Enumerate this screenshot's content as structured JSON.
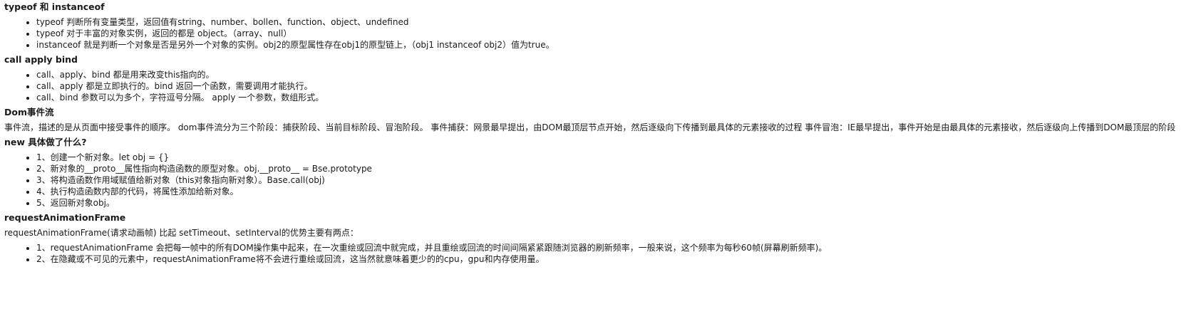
{
  "sections": [
    {
      "heading": "typeof 和 instanceof",
      "items": [
        "typeof 判断所有变量类型，返回值有string、number、bollen、function、object、undefined",
        "typeof 对于丰富的对象实例，返回的都是 object。（array、null）",
        "instanceof 就是判断一个对象是否是另外一个对象的实例。obj2的原型属性存在obj1的原型链上，（obj1 instanceof obj2）值为true。"
      ]
    },
    {
      "heading": "call apply bind",
      "items": [
        "call、apply、bind 都是用来改变this指向的。",
        "call、apply 都是立即执行的。bind 返回一个函数，需要调用才能执行。",
        "call、bind 参数可以为多个，字符逗号分隔。 apply 一个参数，数组形式。"
      ]
    },
    {
      "heading": "Dom事件流",
      "paragraph": "事件流，描述的是从页面中接受事件的顺序。 dom事件流分为三个阶段：捕获阶段、当前目标阶段、冒泡阶段。 事件捕获：网景最早提出，由DOM最顶层节点开始，然后逐级向下传播到最具体的元素接收的过程 事件冒泡：IE最早提出，事件开始是由最具体的元素接收，然后逐级向上传播到DOM最顶层的阶段"
    },
    {
      "heading": "new 具体做了什么?",
      "items": [
        "1、创建一个新对象。let obj = {}",
        "2、新对象的__proto__属性指向构造函数的原型对象。obj.__proto__ = Bse.prototype",
        "3、将构造函数作用域赋值给新对象（this对象指向新对象）。Base.call(obj)",
        "4、执行构造函数内部的代码，将属性添加给新对象。",
        "5、返回新对象obj。"
      ]
    },
    {
      "heading": "requestAnimationFrame",
      "paragraph": "requestAnimationFrame(请求动画帧) 比起 setTimeout、setInterval的优势主要有两点：",
      "items": [
        "1、requestAnimationFrame 会把每一帧中的所有DOM操作集中起来，在一次重绘或回流中就完成，并且重绘或回流的时间间隔紧紧跟随浏览器的刷新频率，一般来说，这个频率为每秒60帧(屏幕刷新频率)。",
        "2、在隐藏或不可见的元素中，requestAnimationFrame将不会进行重绘或回流，这当然就意味着更少的的cpu，gpu和内存使用量。"
      ]
    }
  ]
}
